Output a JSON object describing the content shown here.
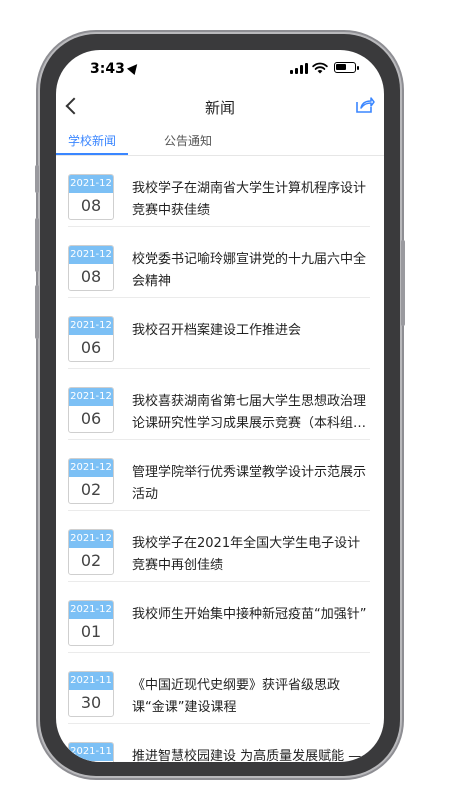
{
  "status_bar": {
    "time": "3:43"
  },
  "nav": {
    "title": "新闻"
  },
  "tabs": [
    {
      "label": "学校新闻",
      "active": true
    },
    {
      "label": "公告通知",
      "active": false
    }
  ],
  "news": [
    {
      "month": "2021-12",
      "day": "08",
      "title": "我校学子在湖南省大学生计算机程序设计竞赛中获佳绩"
    },
    {
      "month": "2021-12",
      "day": "08",
      "title": "校党委书记喻玲娜宣讲党的十九届六中全会精神"
    },
    {
      "month": "2021-12",
      "day": "06",
      "title": "我校召开档案建设工作推进会"
    },
    {
      "month": "2021-12",
      "day": "06",
      "title": "我校喜获湖南省第七届大学生思想政治理论课研究性学习成果展示竞赛（本科组…"
    },
    {
      "month": "2021-12",
      "day": "02",
      "title": "管理学院举行优秀课堂教学设计示范展示活动"
    },
    {
      "month": "2021-12",
      "day": "02",
      "title": "我校学子在2021年全国大学生电子设计竞赛中再创佳绩"
    },
    {
      "month": "2021-12",
      "day": "01",
      "title": "我校师生开始集中接种新冠疫苗“加强针”"
    },
    {
      "month": "2021-11",
      "day": "30",
      "title": "《中国近现代史纲要》获评省级思政课“金课”建设课程"
    },
    {
      "month": "2021-11",
      "day": "",
      "title": "推进智慧校园建设 为高质量发展赋能 —"
    }
  ],
  "colors": {
    "accent": "#3a86ff",
    "date_header": "#7cc0f5"
  }
}
